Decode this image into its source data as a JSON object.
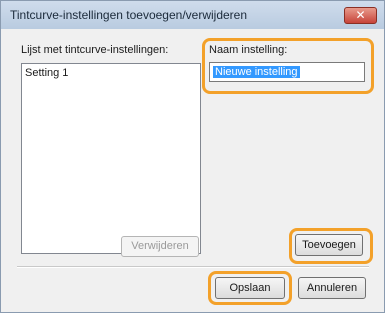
{
  "window": {
    "title": "Tintcurve-instellingen toevoegen/verwijderen",
    "close_glyph": "✕"
  },
  "list": {
    "label": "Lijst met tintcurve-instellingen:",
    "items": [
      "Setting 1"
    ]
  },
  "name_field": {
    "label": "Naam instelling:",
    "value": "Nieuwe instelling"
  },
  "buttons": {
    "delete": "Verwijderen",
    "add": "Toevoegen",
    "save": "Opslaan",
    "cancel": "Annuleren"
  },
  "colors": {
    "highlight": "#f3a12a",
    "selection": "#3399ff"
  }
}
